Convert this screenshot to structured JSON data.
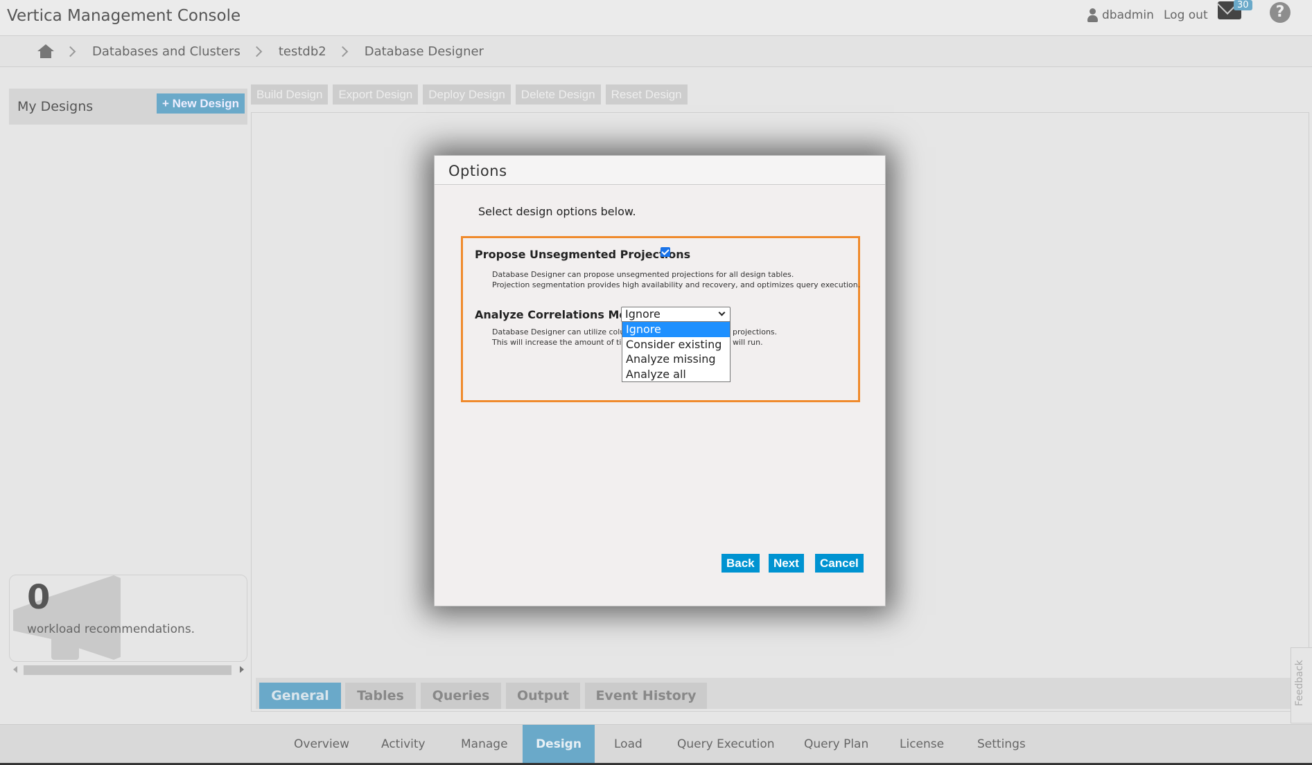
{
  "app": {
    "title": "Vertica Management Console"
  },
  "header": {
    "username": "dbadmin",
    "logout_label": "Log out",
    "mail_count": "30",
    "help_label": "?"
  },
  "breadcrumb": [
    "Databases and Clusters",
    "testdb2",
    "Database Designer"
  ],
  "sidebar": {
    "my_designs_label": "My Designs",
    "new_design_label": "+ New Design"
  },
  "workload": {
    "count": "0",
    "text": "workload recommendations."
  },
  "toolbar": [
    "Build Design",
    "Export Design",
    "Deploy Design",
    "Delete Design",
    "Reset Design"
  ],
  "subtabs": [
    "General",
    "Tables",
    "Queries",
    "Output",
    "Event History"
  ],
  "feedback_label": "Feedback",
  "bottom_nav": [
    "Overview",
    "Activity",
    "Manage",
    "Design",
    "Load",
    "Query Execution",
    "Query Plan",
    "License",
    "Settings"
  ],
  "modal": {
    "title": "Options",
    "intro": "Select design options below.",
    "option1": {
      "label": "Propose Unsegmented Projections",
      "checked": true,
      "desc_line1": "Database Designer can propose unsegmented projections for all design tables.",
      "desc_line2": "Projection segmentation provides high availability and recovery, and optimizes query execution."
    },
    "option2": {
      "label": "Analyze Correlations Mode",
      "selected": "Ignore",
      "desc_line1_left": "Database Designer can utilize colu",
      "desc_line1_right": "projections.",
      "desc_line2_left": "This will increase the amount of tin",
      "desc_line2_right": "will run.",
      "options": [
        "Ignore",
        "Consider existing",
        "Analyze missing",
        "Analyze all"
      ]
    },
    "buttons": {
      "back": "Back",
      "next": "Next",
      "cancel": "Cancel"
    }
  },
  "colors": {
    "accent": "#6aa9c9",
    "primary_button": "#0093d1",
    "highlight_border": "#f08a2c",
    "dropdown_selected": "#1e90ff"
  }
}
